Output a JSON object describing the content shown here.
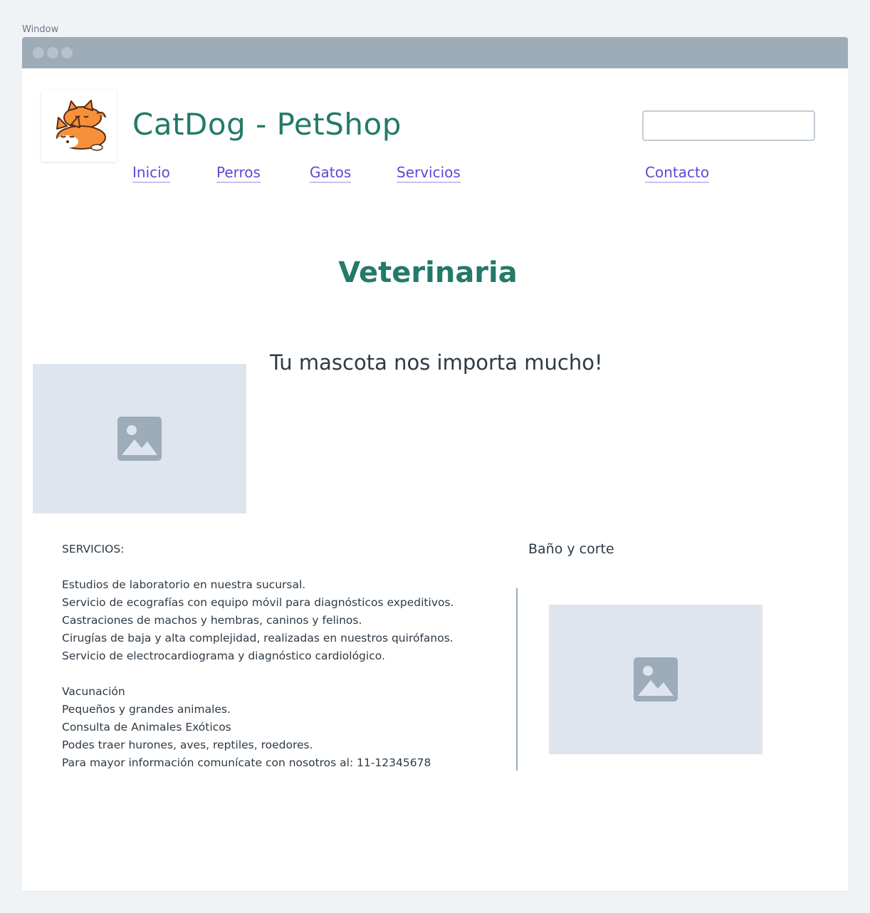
{
  "window": {
    "label": "Window"
  },
  "header": {
    "site_title": "CatDog - PetShop",
    "search_placeholder": "",
    "search_value": ""
  },
  "nav": {
    "items": [
      {
        "label": "Inicio"
      },
      {
        "label": "Perros"
      },
      {
        "label": "Gatos"
      },
      {
        "label": "Servicios"
      },
      {
        "label": "Contacto"
      }
    ]
  },
  "main": {
    "heading": "Veterinaria",
    "tagline": "Tu mascota nos importa mucho!",
    "services_text": "SERVICIOS:\n\nEstudios de laboratorio en nuestra sucursal.\nServicio de ecografías con equipo móvil para diagnósticos expeditivos.\nCastraciones de machos y hembras, caninos y felinos.\nCirugías de baja y alta complejidad, realizadas en nuestros quirófanos.\nServicio de electrocardiograma y diagnóstico cardiológico.\n\nVacunación\nPequeños y grandes animales.\nConsulta de Animales Exóticos\nPodes traer hurones, aves, reptiles, roedores.\nPara mayor información comunícate con nosotros al: 11-12345678"
  },
  "sidebar": {
    "title": "Baño y corte"
  },
  "icons": {
    "logo": "cat-dog-logo-icon",
    "placeholder": "image-placeholder-icon"
  },
  "colors": {
    "brand": "#237a68",
    "link": "#5b48d8",
    "titlebar": "#9cacb9",
    "placeholder_bg": "#dfe5ee"
  }
}
